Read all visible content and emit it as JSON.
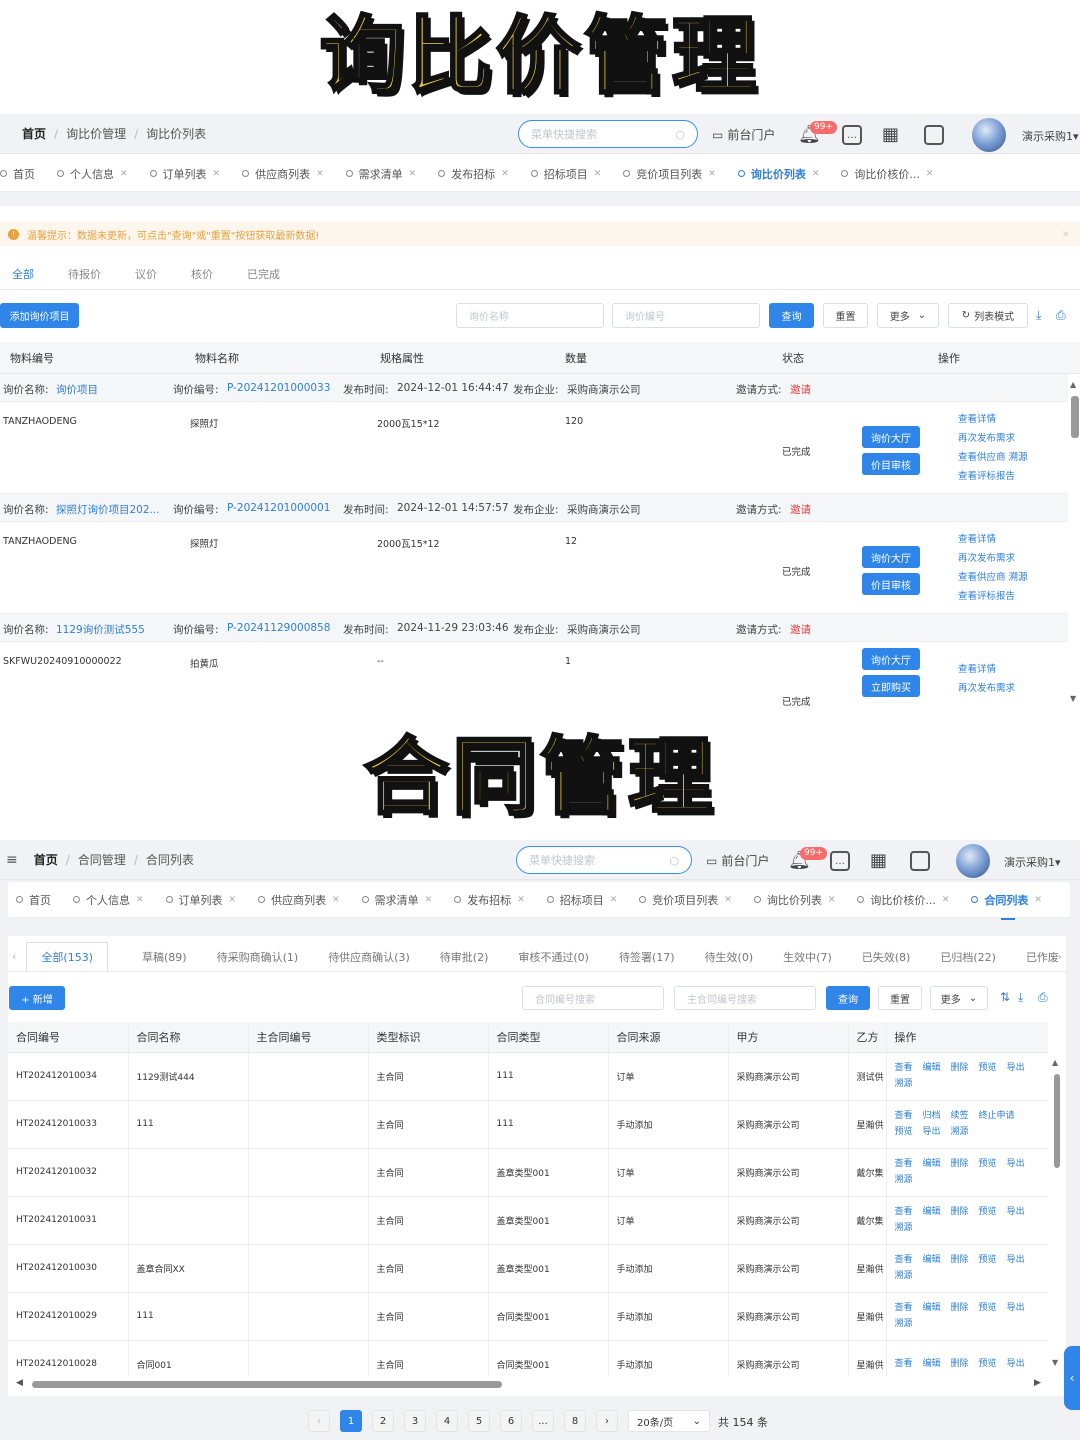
{
  "banner_top": "询比价管理",
  "banner_bottom": "合同管理",
  "panel1": {
    "breadcrumb": [
      "首页",
      "询比价管理",
      "询比价列表"
    ],
    "search_placeholder": "菜单快捷搜索",
    "front_portal": "前台门户",
    "badge": "99+",
    "user": "演示采购1",
    "tabs": [
      "首页",
      "个人信息",
      "订单列表",
      "供应商列表",
      "需求清单",
      "发布招标",
      "招标项目",
      "竞价项目列表",
      "询比价列表",
      "询比价核价..."
    ],
    "active_tab": "询比价列表",
    "notice": "温馨提示：数据未更新，可点击\"查询\"或\"重置\"按钮获取最新数据!",
    "status_tabs": [
      "全部",
      "待报价",
      "议价",
      "核价",
      "已完成"
    ],
    "add_button": "添加询价项目",
    "name_placeholder": "询价名称",
    "code_placeholder": "询价编号",
    "query": "查询",
    "reset": "重置",
    "more": "更多",
    "list_mode": "列表模式",
    "columns": [
      "物料编号",
      "物料名称",
      "规格属性",
      "数量",
      "状态",
      "操作"
    ],
    "groups": [
      {
        "name_label": "询价名称:",
        "name": "询价项目",
        "code_label": "询价编号:",
        "code": "P-20241201000033",
        "time_label": "发布时间:",
        "time": "2024-12-01 16:44:47",
        "company_label": "发布企业:",
        "company": "采购商演示公司",
        "invite_label": "邀请方式:",
        "invite": "邀请",
        "material_code": "TANZHAODENG",
        "material_name": "探照灯",
        "spec": "2000瓦15*12",
        "qty": "120",
        "status": "已完成",
        "btn1": "询价大厅",
        "btn2": "价目审核",
        "links": [
          "查看详情",
          "再次发布需求",
          "查看供应商    溯源",
          "查看评标报告"
        ]
      },
      {
        "name_label": "询价名称:",
        "name": "探照灯询价项目202...",
        "code_label": "询价编号:",
        "code": "P-20241201000001",
        "time_label": "发布时间:",
        "time": "2024-12-01 14:57:57",
        "company_label": "发布企业:",
        "company": "采购商演示公司",
        "invite_label": "邀请方式:",
        "invite": "邀请",
        "material_code": "TANZHAODENG",
        "material_name": "探照灯",
        "spec": "2000瓦15*12",
        "qty": "12",
        "status": "已完成",
        "btn1": "询价大厅",
        "btn2": "价目审核",
        "links": [
          "查看详情",
          "再次发布需求",
          "查看供应商    溯源",
          "查看评标报告"
        ]
      },
      {
        "name_label": "询价名称:",
        "name": "1129询价测试555",
        "code_label": "询价编号:",
        "code": "P-20241129000858",
        "time_label": "发布时间:",
        "time": "2024-11-29 23:03:46",
        "company_label": "发布企业:",
        "company": "采购商演示公司",
        "invite_label": "邀请方式:",
        "invite": "邀请",
        "material_code": "SKFWU20240910000022",
        "material_name": "拍黄瓜",
        "spec": "--",
        "qty": "1",
        "status": "已完成",
        "btn1": "询价大厅",
        "btn2": "立即购买",
        "links": [
          "查看详情",
          "再次发布需求"
        ]
      }
    ]
  },
  "panel2": {
    "breadcrumb": [
      "首页",
      "合同管理",
      "合同列表"
    ],
    "search_placeholder": "菜单快捷搜索",
    "front_portal": "前台门户",
    "badge": "99+",
    "user": "演示采购1",
    "tabs": [
      "首页",
      "个人信息",
      "订单列表",
      "供应商列表",
      "需求清单",
      "发布招标",
      "招标项目",
      "竞价项目列表",
      "询比价列表",
      "询比价核价...",
      "合同列表"
    ],
    "active_tab": "合同列表",
    "status_tabs": [
      "全部(153)",
      "草稿(89)",
      "待采购商确认(1)",
      "待供应商确认(3)",
      "待审批(2)",
      "审核不通过(0)",
      "待签署(17)",
      "待生效(0)",
      "生效中(7)",
      "已失效(8)",
      "已归档(22)",
      "已作废"
    ],
    "add_button": "+ 新增",
    "code_placeholder": "合同编号搜索",
    "main_code_placeholder": "主合同编号搜索",
    "query": "查询",
    "reset": "重置",
    "more": "更多",
    "columns": [
      "合同编号",
      "合同名称",
      "主合同编号",
      "类型标识",
      "合同类型",
      "合同来源",
      "甲方",
      "乙方",
      "操作"
    ],
    "rows": [
      {
        "code": "HT202412010034",
        "name": "1129测试444",
        "main": "",
        "flag": "主合同",
        "type": "111",
        "source": "订单",
        "a": "采购商演示公司",
        "b": "测试供",
        "ops1": [
          "查看",
          "编辑",
          "删除",
          "预览",
          "导出"
        ],
        "ops2": [
          "溯源"
        ]
      },
      {
        "code": "HT202412010033",
        "name": "111",
        "main": "",
        "flag": "主合同",
        "type": "111",
        "source": "手动添加",
        "a": "采购商演示公司",
        "b": "星瀚供",
        "ops1": [
          "查看",
          "归档",
          "续签",
          "终止申请"
        ],
        "ops2": [
          "预览",
          "导出",
          "溯源"
        ]
      },
      {
        "code": "HT202412010032",
        "name": "",
        "main": "",
        "flag": "主合同",
        "type": "盖章类型001",
        "source": "订单",
        "a": "采购商演示公司",
        "b": "戴尔集",
        "ops1": [
          "查看",
          "编辑",
          "删除",
          "预览",
          "导出"
        ],
        "ops2": [
          "溯源"
        ]
      },
      {
        "code": "HT202412010031",
        "name": "",
        "main": "",
        "flag": "主合同",
        "type": "盖章类型001",
        "source": "订单",
        "a": "采购商演示公司",
        "b": "戴尔集",
        "ops1": [
          "查看",
          "编辑",
          "删除",
          "预览",
          "导出"
        ],
        "ops2": [
          "溯源"
        ]
      },
      {
        "code": "HT202412010030",
        "name": "盖章合同XX",
        "main": "",
        "flag": "主合同",
        "type": "盖章类型001",
        "source": "手动添加",
        "a": "采购商演示公司",
        "b": "星瀚供",
        "ops1": [
          "查看",
          "编辑",
          "删除",
          "预览",
          "导出"
        ],
        "ops2": [
          "溯源"
        ]
      },
      {
        "code": "HT202412010029",
        "name": "111",
        "main": "",
        "flag": "主合同",
        "type": "合同类型001",
        "source": "手动添加",
        "a": "采购商演示公司",
        "b": "星瀚供",
        "ops1": [
          "查看",
          "编辑",
          "删除",
          "预览",
          "导出"
        ],
        "ops2": [
          "溯源"
        ]
      },
      {
        "code": "HT202412010028",
        "name": "合同001",
        "main": "",
        "flag": "主合同",
        "type": "合同类型001",
        "source": "手动添加",
        "a": "采购商演示公司",
        "b": "星瀚供",
        "ops1": [
          "查看",
          "编辑",
          "删除",
          "预览",
          "导出"
        ],
        "ops2": []
      }
    ],
    "pagination": {
      "pages": [
        "1",
        "2",
        "3",
        "4",
        "5",
        "6",
        "...",
        "8"
      ],
      "current": "1",
      "page_size": "20条/页",
      "total": "共 154 条"
    }
  }
}
